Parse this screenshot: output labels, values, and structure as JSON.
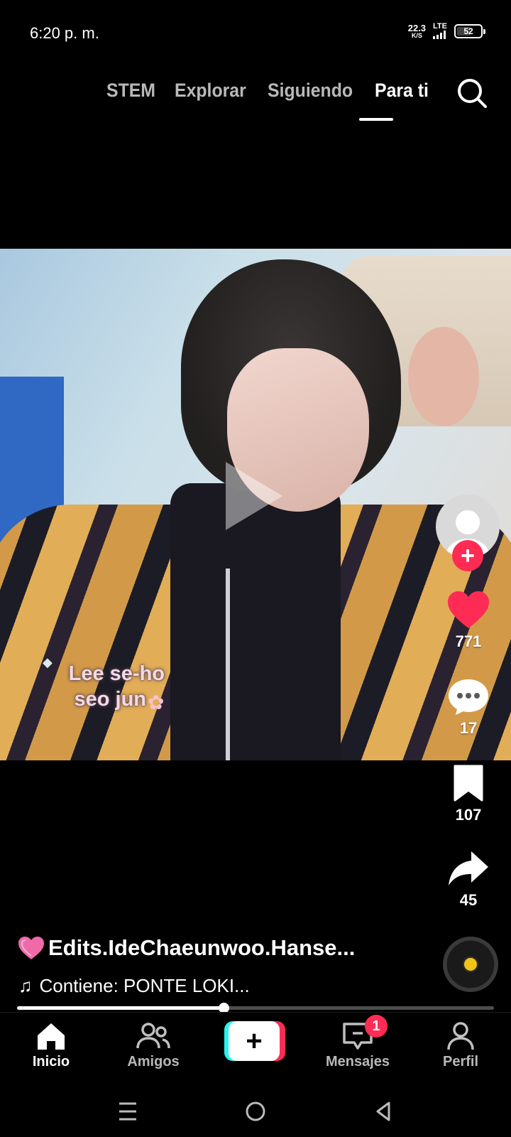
{
  "status_bar": {
    "time": "6:20 p. m.",
    "net_speed_value": "22.3",
    "net_speed_unit": "K/S",
    "network_type": "LTE",
    "battery": "52"
  },
  "top_tabs": [
    {
      "label": "STEM",
      "active": false
    },
    {
      "label": "Explorar",
      "active": false
    },
    {
      "label": "Siguiendo",
      "active": false
    },
    {
      "label": "Para ti",
      "active": true
    }
  ],
  "video": {
    "caption_line1": "Lee se-ho",
    "caption_line2": "seo jun",
    "caption_icon": "cherry-blossom"
  },
  "actions": {
    "follow_label": "+",
    "likes": "771",
    "comments": "17",
    "saves": "107",
    "shares": "45"
  },
  "post": {
    "author_icon": "sparkling-heart",
    "author": "Edits.IdeChaeunwoo.Hanse...",
    "music_icon": "music-note",
    "music": "Contiene: PONTE LOKI..."
  },
  "progress": {
    "fraction": 0.433
  },
  "bottom_nav": {
    "home": "Inicio",
    "friends": "Amigos",
    "create": "+",
    "inbox": "Mensajes",
    "inbox_badge": "1",
    "profile": "Perfil"
  },
  "colors": {
    "accent_red": "#fe2c55",
    "accent_cyan": "#25f4ee",
    "like_red": "#fe2c55",
    "disc_dot": "#f2c318"
  }
}
